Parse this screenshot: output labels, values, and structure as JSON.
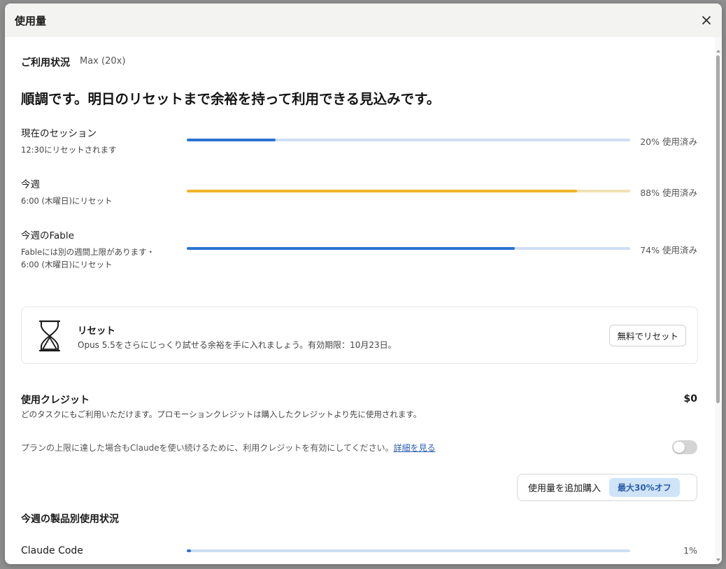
{
  "window": {
    "title": "使用量"
  },
  "plan": {
    "label": "ご利用状況",
    "value": "Max (20x)"
  },
  "headline": "順調です。明日のリセットまで余裕を持って利用できる見込みです。",
  "usage_rows": [
    {
      "title": "現在のセッション",
      "subtitle": "12:30にリセットされます",
      "percent": 20,
      "percent_label": "20% 使用済み",
      "color": "#2c73d2"
    },
    {
      "title": "今週",
      "subtitle": "6:00 (木曜日)にリセット",
      "percent": 88,
      "percent_label": "88% 使用済み",
      "color": "#f0b429"
    },
    {
      "title": "今週のFable",
      "subtitle_line1": "Fableには別の週間上限があります・",
      "subtitle_line2": "6:00 (木曜日)にリセット",
      "percent": 74,
      "percent_label": "74% 使用済み",
      "color": "#2c73d2"
    }
  ],
  "reset_card": {
    "icon": "hourglass-icon",
    "title": "リセット",
    "description": "Opus 5.5をさらにじっくり試せる余裕を手に入れましょう。有効期限：10月23日。",
    "button_label": "無料でリセット"
  },
  "credits": {
    "title": "使用クレジット",
    "amount": "$0",
    "description": "どのタスクにもご利用いただけます。プロモーションクレジットは購入したクレジットより先に使用されます。",
    "enable_text": "プランの上限に達した場合もClaudeを使い続けるために、利用クレジットを有効にしてください。",
    "enable_link": "詳細を見る",
    "toggle_on": false
  },
  "buy": {
    "label": "使用量を追加購入",
    "badge": "最大30%オフ"
  },
  "products": {
    "title": "今週の製品別使用状況",
    "items": [
      {
        "name": "Claude Code",
        "percent": 1,
        "percent_label": "1%"
      }
    ]
  }
}
